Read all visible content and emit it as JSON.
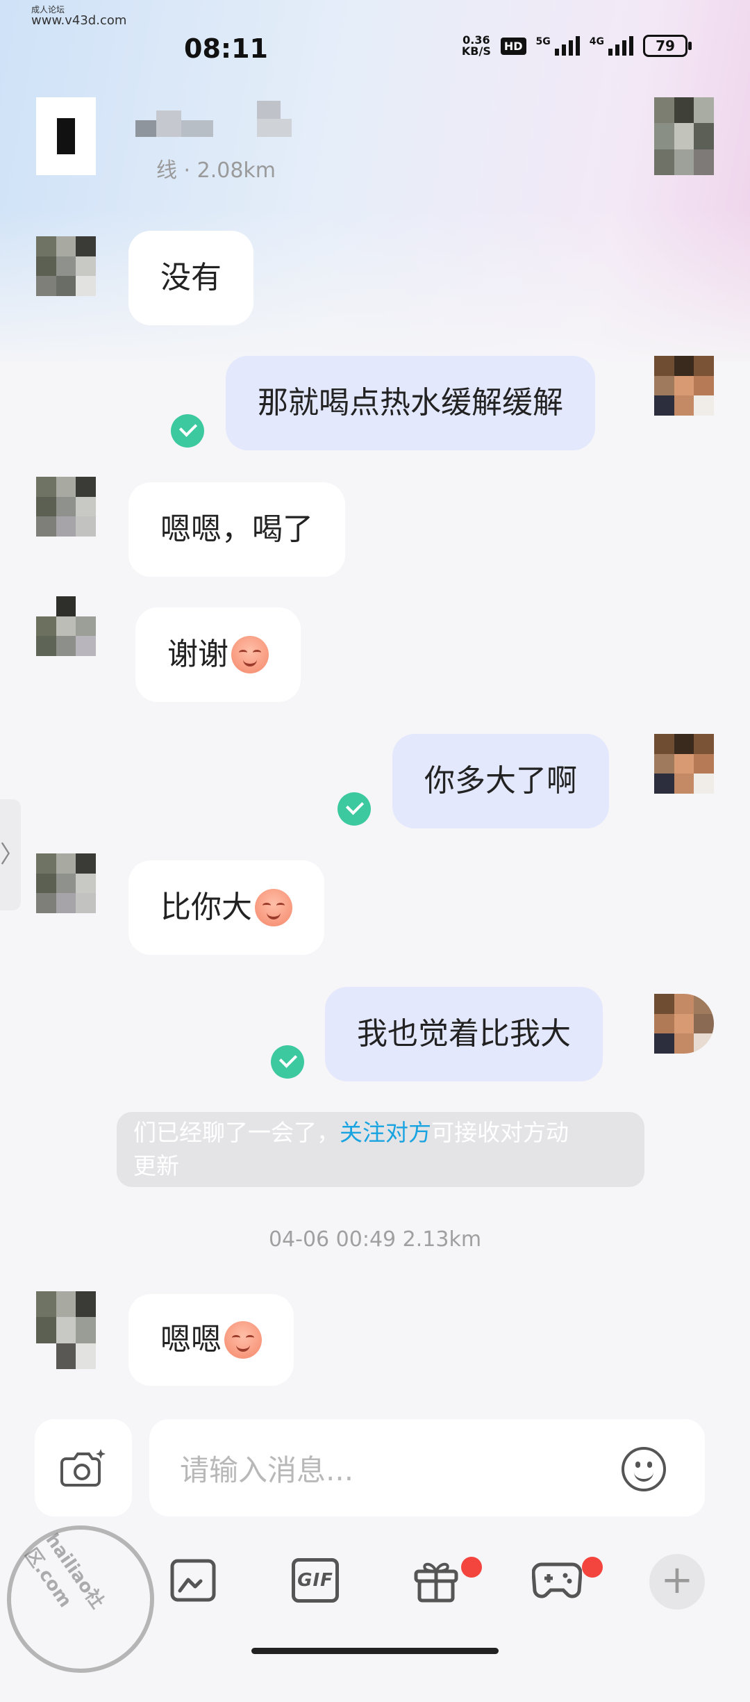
{
  "watermark": {
    "line1": "成人论坛",
    "line2": "www.v43d.com"
  },
  "status_bar": {
    "time": "08:11",
    "net_speed": "0.36",
    "net_unit": "KB/S",
    "hd": "HD",
    "signal_5g": "5G",
    "signal_4g": "4G",
    "battery": "79"
  },
  "header": {
    "distance": "线 · 2.08km"
  },
  "messages": [
    {
      "dir": "in",
      "text": "没有"
    },
    {
      "dir": "out",
      "text": "那就喝点热水缓解缓解",
      "read": true
    },
    {
      "dir": "in",
      "text": "嗯嗯，喝了"
    },
    {
      "dir": "in",
      "text": "谢谢",
      "emoji": "smiling-face-icon"
    },
    {
      "dir": "out",
      "text": "你多大了啊",
      "read": true
    },
    {
      "dir": "in",
      "text": "比你大",
      "emoji": "smiling-face-icon"
    },
    {
      "dir": "out",
      "text": "我也觉着比我大",
      "read": true
    },
    {
      "dir": "in",
      "text": "嗯嗯",
      "emoji": "smiling-face-icon"
    }
  ],
  "notice": {
    "before": "们已经聊了一会了，",
    "link": "关注对方",
    "after": "可接收对方动",
    "line2": "更新"
  },
  "timestamp": "04-06 00:49  2.13km",
  "input": {
    "placeholder": "请输入消息..."
  },
  "toolbar": {
    "gif_label": "GIF",
    "plus": "+"
  },
  "left_tab": "〉",
  "stamp_text": "hailiao社区.com",
  "colors": {
    "read_check": "#3dc9a0",
    "outgoing_bubble": "#e4e8fc",
    "link": "#19a3e0",
    "badge": "#f4443e"
  }
}
